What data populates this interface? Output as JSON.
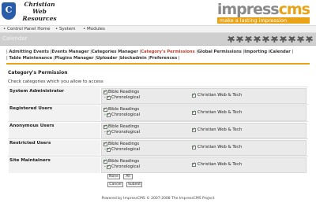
{
  "header": {
    "logo_badge": "C",
    "logo_line1": "Christian",
    "logo_line2": "Web",
    "logo_line3": "Resources",
    "brand_impress": "impress",
    "brand_cms": "cms",
    "brand_tagline": "make a lasting impression"
  },
  "menubar": {
    "items": [
      "• Control Panel Home",
      "• System",
      "• Modules"
    ]
  },
  "titlebar": {
    "title": "Calendar"
  },
  "tabs": [
    "Admitting Events",
    "Events Manager",
    "Categories Manager",
    "Category's Permissions",
    "Global Permissions",
    "Importing iCalendar",
    "Table Maintenance",
    "Plugins Manager",
    "Uploader",
    "blockadmin",
    "Preferences"
  ],
  "section": {
    "title": "Category's Permission",
    "hint": "Check categories which you allow to access"
  },
  "options": {
    "bible_readings": "Bible Readings",
    "chronological": "Chronological",
    "christian_web": "Christian Web & Tech"
  },
  "groups": [
    {
      "name": "System Administrator"
    },
    {
      "name": "Registered Users"
    },
    {
      "name": "Anonymous Users"
    },
    {
      "name": "Restricted Users"
    },
    {
      "name": "Site Maintainers"
    }
  ],
  "buttons": {
    "none": "None",
    "all": "All",
    "cancel": "Cancel",
    "submit": "Submit"
  },
  "footer": {
    "text": "Powered by ImpressCMS © 2007-2008 The ImpressCMS Project"
  }
}
